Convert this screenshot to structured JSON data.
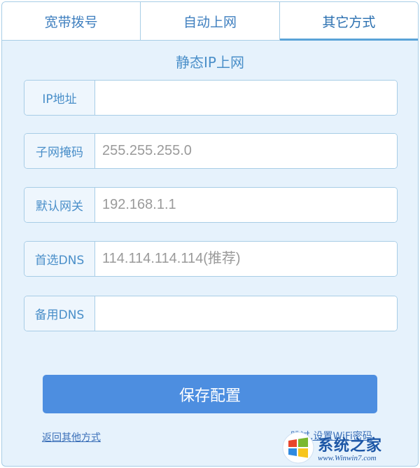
{
  "tabs": [
    {
      "label": "宽带拨号",
      "active": false
    },
    {
      "label": "自动上网",
      "active": false
    },
    {
      "label": "其它方式",
      "active": true
    }
  ],
  "section_title": "静态IP上网",
  "fields": {
    "ip": {
      "label": "IP地址",
      "value": "",
      "placeholder": ""
    },
    "subnet": {
      "label": "子网掩码",
      "value": "",
      "placeholder": "255.255.255.0"
    },
    "gateway": {
      "label": "默认网关",
      "value": "",
      "placeholder": "192.168.1.1"
    },
    "dns1": {
      "label": "首选DNS",
      "value": "",
      "placeholder": "114.114.114.114(推荐)"
    },
    "dns2": {
      "label": "备用DNS",
      "value": "",
      "placeholder": ""
    }
  },
  "save_label": "保存配置",
  "links": {
    "back": "返回其他方式",
    "skip": "跳过,设置WiFi密码"
  },
  "watermark": {
    "title": "系统之家",
    "url": "www.Winwin7.com",
    "icon": "windows-logo-icon"
  },
  "colors": {
    "accent": "#4d8ee0",
    "border": "#a8cde6",
    "panel_bg": "#e6f2fc",
    "label_text": "#4a8fc9"
  }
}
